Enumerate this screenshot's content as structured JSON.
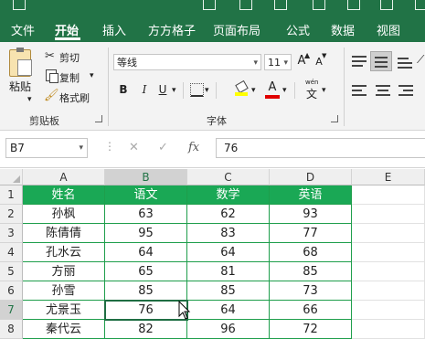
{
  "menu": {
    "tabs": [
      "文件",
      "开始",
      "插入",
      "方方格子",
      "页面布局",
      "公式",
      "数据",
      "视图"
    ],
    "active_tab": "开始"
  },
  "ribbon": {
    "clipboard": {
      "paste": "粘贴",
      "cut": "剪切",
      "copy": "复制",
      "format_painter": "格式刷",
      "group_label": "剪贴板"
    },
    "font": {
      "font_name": "等线",
      "font_size": "11",
      "bold": "B",
      "italic": "I",
      "underline": "U",
      "font_color_glyph": "A",
      "wen_glyph": "wén",
      "wen_char": "文",
      "grow_font": "A",
      "shrink_font": "A",
      "group_label": "字体"
    }
  },
  "formula_bar": {
    "name_box": "B7",
    "cancel": "✕",
    "enter": "✓",
    "fx": "fx",
    "value": "76"
  },
  "sheet": {
    "columns": [
      "A",
      "B",
      "C",
      "D",
      "E"
    ],
    "rows": [
      "1",
      "2",
      "3",
      "4",
      "5",
      "6",
      "7",
      "8"
    ],
    "selected_column": "B",
    "selected_row": "7",
    "active_cell": "B7",
    "header": [
      "姓名",
      "语文",
      "数学",
      "英语"
    ],
    "data": [
      [
        "孙枫",
        "63",
        "62",
        "93"
      ],
      [
        "陈倩倩",
        "95",
        "83",
        "77"
      ],
      [
        "孔水云",
        "64",
        "64",
        "68"
      ],
      [
        "方丽",
        "65",
        "81",
        "85"
      ],
      [
        "孙雪",
        "85",
        "85",
        "73"
      ],
      [
        "尤景玉",
        "76",
        "64",
        "66"
      ],
      [
        "秦代云",
        "82",
        "96",
        "72"
      ]
    ]
  },
  "colors": {
    "excel_green": "#217346",
    "header_fill": "#1aa855",
    "highlight_yellow": "#ffff00",
    "font_red": "#e00000"
  }
}
